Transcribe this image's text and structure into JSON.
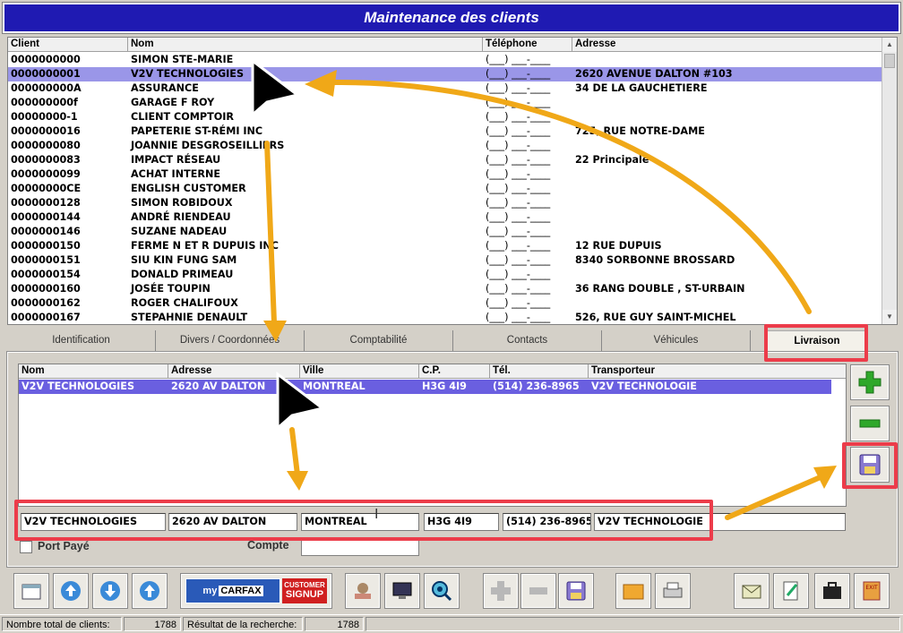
{
  "window": {
    "title": "Maintenance des clients"
  },
  "client_list": {
    "columns": [
      "Client",
      "Nom",
      "Téléphone",
      "Adresse"
    ],
    "rows": [
      {
        "client": "0000000000",
        "nom": "SIMON STE-MARIE",
        "telephone": "(___) ___-____",
        "adresse": ""
      },
      {
        "client": "0000000001",
        "nom": "V2V TECHNOLOGIES",
        "telephone": "(___) ___-____",
        "adresse": "2620 AVENUE DALTON #103"
      },
      {
        "client": "000000000A",
        "nom": "ASSURANCE",
        "telephone": "(___) ___-____",
        "adresse": "34 DE LA GAUCHETIERE"
      },
      {
        "client": "000000000f",
        "nom": "GARAGE F ROY",
        "telephone": "(___) ___-____",
        "adresse": ""
      },
      {
        "client": "00000000-1",
        "nom": "CLIENT COMPTOIR",
        "telephone": "(___) ___-____",
        "adresse": ""
      },
      {
        "client": "0000000016",
        "nom": "PAPETERIE ST-RÉMI INC",
        "telephone": "(___) ___-____",
        "adresse": "725, RUE NOTRE-DAME"
      },
      {
        "client": "0000000080",
        "nom": "JOANNIE DESGROSEILLIERS",
        "telephone": "(___) ___-____",
        "adresse": ""
      },
      {
        "client": "0000000083",
        "nom": "IMPACT RÉSEAU",
        "telephone": "(___) ___-____",
        "adresse": "22 Principale"
      },
      {
        "client": "0000000099",
        "nom": "ACHAT INTERNE",
        "telephone": "(___) ___-____",
        "adresse": ""
      },
      {
        "client": "00000000CE",
        "nom": "ENGLISH CUSTOMER",
        "telephone": "(___) ___-____",
        "adresse": ""
      },
      {
        "client": "0000000128",
        "nom": "SIMON ROBIDOUX",
        "telephone": "(___) ___-____",
        "adresse": ""
      },
      {
        "client": "0000000144",
        "nom": "ANDRÉ RIENDEAU",
        "telephone": "(___) ___-____",
        "adresse": ""
      },
      {
        "client": "0000000146",
        "nom": "SUZANE NADEAU",
        "telephone": "(___) ___-____",
        "adresse": ""
      },
      {
        "client": "0000000150",
        "nom": "FERME N ET R DUPUIS INC",
        "telephone": "(___) ___-____",
        "adresse": "12 RUE DUPUIS"
      },
      {
        "client": "0000000151",
        "nom": "SIU KIN FUNG SAM",
        "telephone": "(___) ___-____",
        "adresse": "8340 SORBONNE BROSSARD"
      },
      {
        "client": "0000000154",
        "nom": "DONALD PRIMEAU",
        "telephone": "(___) ___-____",
        "adresse": ""
      },
      {
        "client": "0000000160",
        "nom": "JOSÉE TOUPIN",
        "telephone": "(___) ___-____",
        "adresse": "36 RANG DOUBLE , ST-URBAIN"
      },
      {
        "client": "0000000162",
        "nom": "ROGER CHALIFOUX",
        "telephone": "(___) ___-____",
        "adresse": ""
      },
      {
        "client": "0000000167",
        "nom": "STEPAHNIE DENAULT",
        "telephone": "(___) ___-____",
        "adresse": "526, RUE GUY SAINT-MICHEL"
      }
    ]
  },
  "tabs": [
    "Identification",
    "Divers / Coordonnées",
    "Comptabilité",
    "Contacts",
    "Véhicules",
    "Livraison"
  ],
  "livraison": {
    "columns": [
      "Nom",
      "Adresse",
      "Ville",
      "C.P.",
      "Tél.",
      "Transporteur"
    ],
    "row": {
      "nom": "V2V TECHNOLOGIES",
      "adresse": "2620 AV DALTON",
      "ville": "MONTREAL",
      "cp": "H3G 4I9",
      "tel": "(514) 236-8965",
      "transporteur": "V2V TECHNOLOGIE"
    },
    "edit": {
      "nom": "V2V TECHNOLOGIES",
      "adresse": "2620 AV DALTON",
      "ville": "MONTREAL",
      "cp": "H3G 4I9",
      "tel": "(514) 236-8965",
      "transporteur": "V2V TECHNOLOGIE"
    },
    "port_paye_label": "Port Payé",
    "compte_label": "Compte"
  },
  "toolbar": {
    "carfax_my": "my",
    "carfax_brand": "CARFAX",
    "carfax_signup_1": "CUSTOMER",
    "carfax_signup_2": "SIGNUP",
    "exit_label": "EXIT"
  },
  "status": {
    "total_label": "Nombre total de clients:",
    "total_value": "1788",
    "result_label": "Résultat de la recherche:",
    "result_value": "1788"
  },
  "colors": {
    "title_bg": "#1f1ab2",
    "selection": "#9a96e8",
    "annotation_red": "#ec3c4a",
    "annotation_arrow": "#f0a818"
  }
}
